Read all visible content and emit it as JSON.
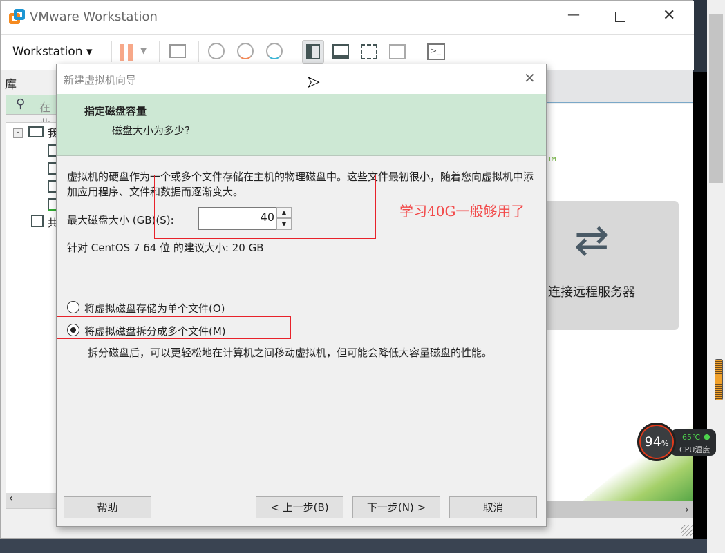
{
  "app": {
    "title": "VMware Workstation",
    "menu_label": "Workstation"
  },
  "library": {
    "title": "库",
    "search_placeholder": "在此",
    "tree": [
      {
        "label": "我"
      },
      {
        "label": "共"
      }
    ]
  },
  "home": {
    "connect_remote": "连接远程服务器",
    "tm": "TM"
  },
  "dialog": {
    "title": "新建虚拟机向导",
    "heading": "指定磁盘容量",
    "subheading": "磁盘大小为多少?",
    "description": "虚拟机的硬盘作为一个或多个文件存储在主机的物理磁盘中。这些文件最初很小，随着您向虚拟机中添加应用程序、文件和数据而逐渐变大。",
    "max_size_label": "最大磁盘大小 (GB)(S):",
    "max_size_value": "40",
    "recommend": "针对 CentOS 7 64 位 的建议大小: 20 GB",
    "options": [
      {
        "label": "将虚拟磁盘存储为单个文件(O)",
        "selected": false
      },
      {
        "label": "将虚拟磁盘拆分成多个文件(M)",
        "selected": true
      }
    ],
    "split_note": "拆分磁盘后，可以更轻松地在计算机之间移动虚拟机，但可能会降低大容量磁盘的性能。",
    "buttons": {
      "help": "帮助",
      "back": "< 上一步(B)",
      "next": "下一步(N) >",
      "cancel": "取消"
    }
  },
  "annotation": {
    "text": "学习40G一般够用了",
    "color": "#e8222a"
  },
  "cpu_widget": {
    "usage": "94",
    "unit": "%",
    "temp": "65℃",
    "label": "CPU温度"
  }
}
